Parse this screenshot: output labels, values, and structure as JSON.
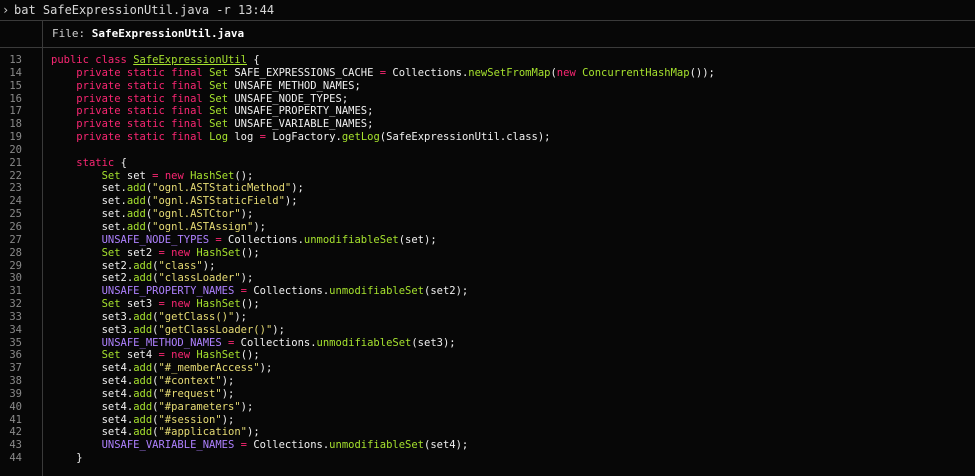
{
  "terminal": {
    "prompt_glyph": "›",
    "command": "bat SafeExpressionUtil.java -r 13:44"
  },
  "file_header": {
    "label": "File:",
    "filename": "SafeExpressionUtil.java"
  },
  "colors": {
    "keyword": "#f92672",
    "type": "#a6e22e",
    "constant": "#ae81ff",
    "string": "#e6db74",
    "plain": "#f0f0f0",
    "line_number": "#8a8a8a",
    "background": "#070707"
  },
  "lines": [
    {
      "n": "13",
      "t": [
        [
          "kw",
          "public "
        ],
        [
          "kw",
          "class "
        ],
        [
          "cls",
          "SafeExpressionUtil"
        ],
        [
          "pl",
          " {"
        ]
      ]
    },
    {
      "n": "14",
      "t": [
        [
          "pl",
          "    "
        ],
        [
          "kw",
          "private static final "
        ],
        [
          "ty",
          "Set "
        ],
        [
          "pl",
          "SAFE_EXPRESSIONS_CACHE "
        ],
        [
          "kw",
          "= "
        ],
        [
          "pl",
          "Collections."
        ],
        [
          "fn",
          "newSetFromMap"
        ],
        [
          "pl",
          "("
        ],
        [
          "kw",
          "new "
        ],
        [
          "fn",
          "ConcurrentHashMap"
        ],
        [
          "pl",
          "());"
        ]
      ]
    },
    {
      "n": "15",
      "t": [
        [
          "pl",
          "    "
        ],
        [
          "kw",
          "private static final "
        ],
        [
          "ty",
          "Set "
        ],
        [
          "pl",
          "UNSAFE_METHOD_NAMES;"
        ]
      ]
    },
    {
      "n": "16",
      "t": [
        [
          "pl",
          "    "
        ],
        [
          "kw",
          "private static final "
        ],
        [
          "ty",
          "Set "
        ],
        [
          "pl",
          "UNSAFE_NODE_TYPES;"
        ]
      ]
    },
    {
      "n": "17",
      "t": [
        [
          "pl",
          "    "
        ],
        [
          "kw",
          "private static final "
        ],
        [
          "ty",
          "Set "
        ],
        [
          "pl",
          "UNSAFE_PROPERTY_NAMES;"
        ]
      ]
    },
    {
      "n": "18",
      "t": [
        [
          "pl",
          "    "
        ],
        [
          "kw",
          "private static final "
        ],
        [
          "ty",
          "Set "
        ],
        [
          "pl",
          "UNSAFE_VARIABLE_NAMES;"
        ]
      ]
    },
    {
      "n": "19",
      "t": [
        [
          "pl",
          "    "
        ],
        [
          "kw",
          "private static final "
        ],
        [
          "ty",
          "Log "
        ],
        [
          "pl",
          "log "
        ],
        [
          "kw",
          "= "
        ],
        [
          "pl",
          "LogFactory."
        ],
        [
          "fn",
          "getLog"
        ],
        [
          "pl",
          "(SafeExpressionUtil.class);"
        ]
      ]
    },
    {
      "n": "20",
      "t": []
    },
    {
      "n": "21",
      "t": [
        [
          "pl",
          "    "
        ],
        [
          "kw",
          "static "
        ],
        [
          "pl",
          "{"
        ]
      ]
    },
    {
      "n": "22",
      "t": [
        [
          "pl",
          "        "
        ],
        [
          "ty",
          "Set "
        ],
        [
          "pl",
          "set "
        ],
        [
          "kw",
          "= new "
        ],
        [
          "fn",
          "HashSet"
        ],
        [
          "pl",
          "();"
        ]
      ]
    },
    {
      "n": "23",
      "t": [
        [
          "pl",
          "        set."
        ],
        [
          "fn",
          "add"
        ],
        [
          "pl",
          "("
        ],
        [
          "str",
          "\"ognl.ASTStaticMethod\""
        ],
        [
          "pl",
          ");"
        ]
      ]
    },
    {
      "n": "24",
      "t": [
        [
          "pl",
          "        set."
        ],
        [
          "fn",
          "add"
        ],
        [
          "pl",
          "("
        ],
        [
          "str",
          "\"ognl.ASTStaticField\""
        ],
        [
          "pl",
          ");"
        ]
      ]
    },
    {
      "n": "25",
      "t": [
        [
          "pl",
          "        set."
        ],
        [
          "fn",
          "add"
        ],
        [
          "pl",
          "("
        ],
        [
          "str",
          "\"ognl.ASTCtor\""
        ],
        [
          "pl",
          ");"
        ]
      ]
    },
    {
      "n": "26",
      "t": [
        [
          "pl",
          "        set."
        ],
        [
          "fn",
          "add"
        ],
        [
          "pl",
          "("
        ],
        [
          "str",
          "\"ognl.ASTAssign\""
        ],
        [
          "pl",
          ");"
        ]
      ]
    },
    {
      "n": "27",
      "t": [
        [
          "pl",
          "        "
        ],
        [
          "cn",
          "UNSAFE_NODE_TYPES "
        ],
        [
          "kw",
          "= "
        ],
        [
          "pl",
          "Collections."
        ],
        [
          "fn",
          "unmodifiableSet"
        ],
        [
          "pl",
          "(set);"
        ]
      ]
    },
    {
      "n": "28",
      "t": [
        [
          "pl",
          "        "
        ],
        [
          "ty",
          "Set "
        ],
        [
          "pl",
          "set2 "
        ],
        [
          "kw",
          "= new "
        ],
        [
          "fn",
          "HashSet"
        ],
        [
          "pl",
          "();"
        ]
      ]
    },
    {
      "n": "29",
      "t": [
        [
          "pl",
          "        set2."
        ],
        [
          "fn",
          "add"
        ],
        [
          "pl",
          "("
        ],
        [
          "str",
          "\"class\""
        ],
        [
          "pl",
          ");"
        ]
      ]
    },
    {
      "n": "30",
      "t": [
        [
          "pl",
          "        set2."
        ],
        [
          "fn",
          "add"
        ],
        [
          "pl",
          "("
        ],
        [
          "str",
          "\"classLoader\""
        ],
        [
          "pl",
          ");"
        ]
      ]
    },
    {
      "n": "31",
      "t": [
        [
          "pl",
          "        "
        ],
        [
          "cn",
          "UNSAFE_PROPERTY_NAMES "
        ],
        [
          "kw",
          "= "
        ],
        [
          "pl",
          "Collections."
        ],
        [
          "fn",
          "unmodifiableSet"
        ],
        [
          "pl",
          "(set2);"
        ]
      ]
    },
    {
      "n": "32",
      "t": [
        [
          "pl",
          "        "
        ],
        [
          "ty",
          "Set "
        ],
        [
          "pl",
          "set3 "
        ],
        [
          "kw",
          "= new "
        ],
        [
          "fn",
          "HashSet"
        ],
        [
          "pl",
          "();"
        ]
      ]
    },
    {
      "n": "33",
      "t": [
        [
          "pl",
          "        set3."
        ],
        [
          "fn",
          "add"
        ],
        [
          "pl",
          "("
        ],
        [
          "str",
          "\"getClass()\""
        ],
        [
          "pl",
          ");"
        ]
      ]
    },
    {
      "n": "34",
      "t": [
        [
          "pl",
          "        set3."
        ],
        [
          "fn",
          "add"
        ],
        [
          "pl",
          "("
        ],
        [
          "str",
          "\"getClassLoader()\""
        ],
        [
          "pl",
          ");"
        ]
      ]
    },
    {
      "n": "35",
      "t": [
        [
          "pl",
          "        "
        ],
        [
          "cn",
          "UNSAFE_METHOD_NAMES "
        ],
        [
          "kw",
          "= "
        ],
        [
          "pl",
          "Collections."
        ],
        [
          "fn",
          "unmodifiableSet"
        ],
        [
          "pl",
          "(set3);"
        ]
      ]
    },
    {
      "n": "36",
      "t": [
        [
          "pl",
          "        "
        ],
        [
          "ty",
          "Set "
        ],
        [
          "pl",
          "set4 "
        ],
        [
          "kw",
          "= new "
        ],
        [
          "fn",
          "HashSet"
        ],
        [
          "pl",
          "();"
        ]
      ]
    },
    {
      "n": "37",
      "t": [
        [
          "pl",
          "        set4."
        ],
        [
          "fn",
          "add"
        ],
        [
          "pl",
          "("
        ],
        [
          "str",
          "\"#_memberAccess\""
        ],
        [
          "pl",
          ");"
        ]
      ]
    },
    {
      "n": "38",
      "t": [
        [
          "pl",
          "        set4."
        ],
        [
          "fn",
          "add"
        ],
        [
          "pl",
          "("
        ],
        [
          "str",
          "\"#context\""
        ],
        [
          "pl",
          ");"
        ]
      ]
    },
    {
      "n": "39",
      "t": [
        [
          "pl",
          "        set4."
        ],
        [
          "fn",
          "add"
        ],
        [
          "pl",
          "("
        ],
        [
          "str",
          "\"#request\""
        ],
        [
          "pl",
          ");"
        ]
      ]
    },
    {
      "n": "40",
      "t": [
        [
          "pl",
          "        set4."
        ],
        [
          "fn",
          "add"
        ],
        [
          "pl",
          "("
        ],
        [
          "str",
          "\"#parameters\""
        ],
        [
          "pl",
          ");"
        ]
      ]
    },
    {
      "n": "41",
      "t": [
        [
          "pl",
          "        set4."
        ],
        [
          "fn",
          "add"
        ],
        [
          "pl",
          "("
        ],
        [
          "str",
          "\"#session\""
        ],
        [
          "pl",
          ");"
        ]
      ]
    },
    {
      "n": "42",
      "t": [
        [
          "pl",
          "        set4."
        ],
        [
          "fn",
          "add"
        ],
        [
          "pl",
          "("
        ],
        [
          "str",
          "\"#application\""
        ],
        [
          "pl",
          ");"
        ]
      ]
    },
    {
      "n": "43",
      "t": [
        [
          "pl",
          "        "
        ],
        [
          "cn",
          "UNSAFE_VARIABLE_NAMES "
        ],
        [
          "kw",
          "= "
        ],
        [
          "pl",
          "Collections."
        ],
        [
          "fn",
          "unmodifiableSet"
        ],
        [
          "pl",
          "(set4);"
        ]
      ]
    },
    {
      "n": "44",
      "t": [
        [
          "pl",
          "    }"
        ]
      ]
    }
  ]
}
